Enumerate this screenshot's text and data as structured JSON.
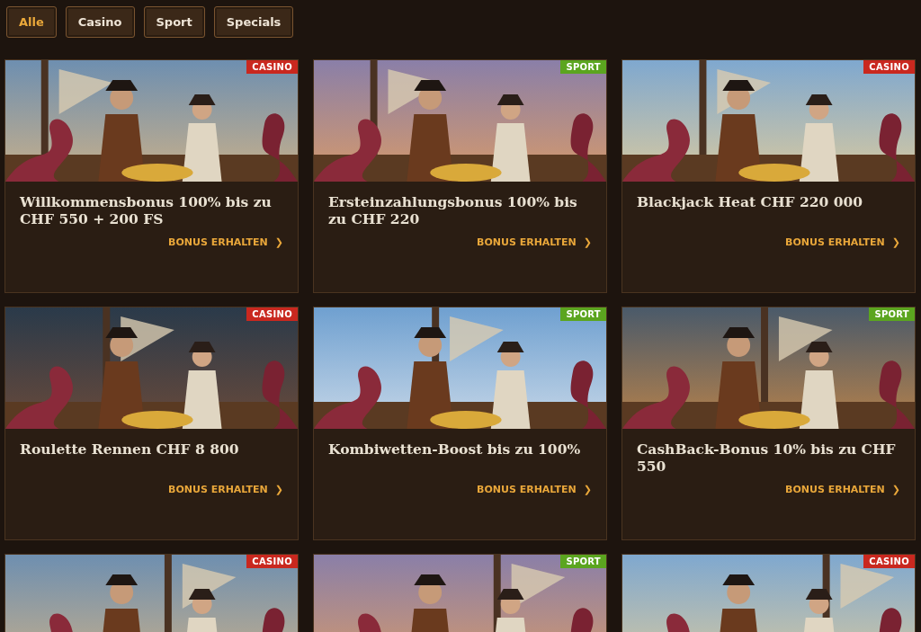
{
  "tabs": [
    {
      "label": "Alle",
      "selected": true
    },
    {
      "label": "Casino",
      "selected": false
    },
    {
      "label": "Sport",
      "selected": false
    },
    {
      "label": "Specials",
      "selected": false
    }
  ],
  "cards": [
    {
      "badge": {
        "label": "CASINO",
        "color": "#c9281f"
      },
      "title": "Willkommensbonus 100% bis zu CHF 550 + 200 FS",
      "link": "BONUS ERHALTEN",
      "arrow": "❯"
    },
    {
      "badge": {
        "label": "SPORT",
        "color": "#5ba51f"
      },
      "title": "Ersteinzahlungsbonus 100% bis zu CHF 220",
      "link": "BONUS ERHALTEN",
      "arrow": "❯"
    },
    {
      "badge": {
        "label": "CASINO",
        "color": "#c9281f"
      },
      "title": "Blackjack Heat CHF 220 000",
      "link": "BONUS ERHALTEN",
      "arrow": "❯"
    },
    {
      "badge": {
        "label": "CASINO",
        "color": "#c9281f"
      },
      "title": "Roulette Rennen CHF 8 800",
      "link": "BONUS ERHALTEN",
      "arrow": "❯"
    },
    {
      "badge": {
        "label": "SPORT",
        "color": "#5ba51f"
      },
      "title": "Kombiwetten-Boost bis zu 100%",
      "link": "BONUS ERHALTEN",
      "arrow": "❯"
    },
    {
      "badge": {
        "label": "SPORT",
        "color": "#5ba51f"
      },
      "title": "CashBack-Bonus 10% bis zu CHF 550",
      "link": "BONUS ERHALTEN",
      "arrow": "❯"
    },
    {
      "badge": {
        "label": "CASINO",
        "color": "#c9281f"
      }
    },
    {
      "badge": {
        "label": "SPORT",
        "color": "#5ba51f"
      }
    },
    {
      "badge": {
        "label": "CASINO",
        "color": "#c9281f"
      }
    }
  ]
}
